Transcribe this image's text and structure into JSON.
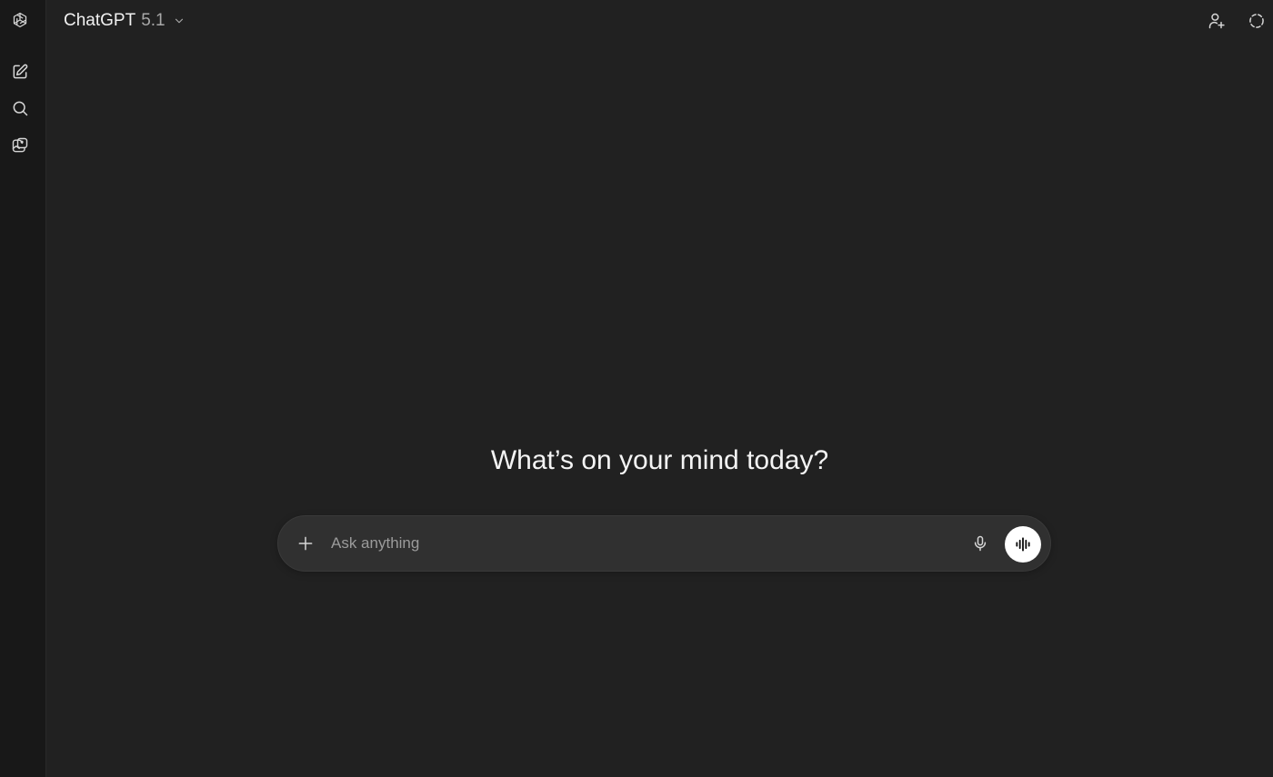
{
  "header": {
    "model_name": "ChatGPT",
    "model_version": "5.1"
  },
  "rail": {
    "items": [
      {
        "name": "new-chat",
        "icon": "compose-icon"
      },
      {
        "name": "search",
        "icon": "search-icon"
      },
      {
        "name": "library",
        "icon": "images-icon"
      }
    ]
  },
  "top_actions": [
    {
      "name": "share",
      "icon": "add-person-icon"
    },
    {
      "name": "temporary-chat",
      "icon": "dashed-circle-icon"
    }
  ],
  "main": {
    "heading": "What’s on your mind today?"
  },
  "composer": {
    "placeholder": "Ask anything"
  },
  "colors": {
    "background": "#212121",
    "rail": "#181818",
    "composer": "#303030",
    "voice_button": "#ffffff"
  }
}
